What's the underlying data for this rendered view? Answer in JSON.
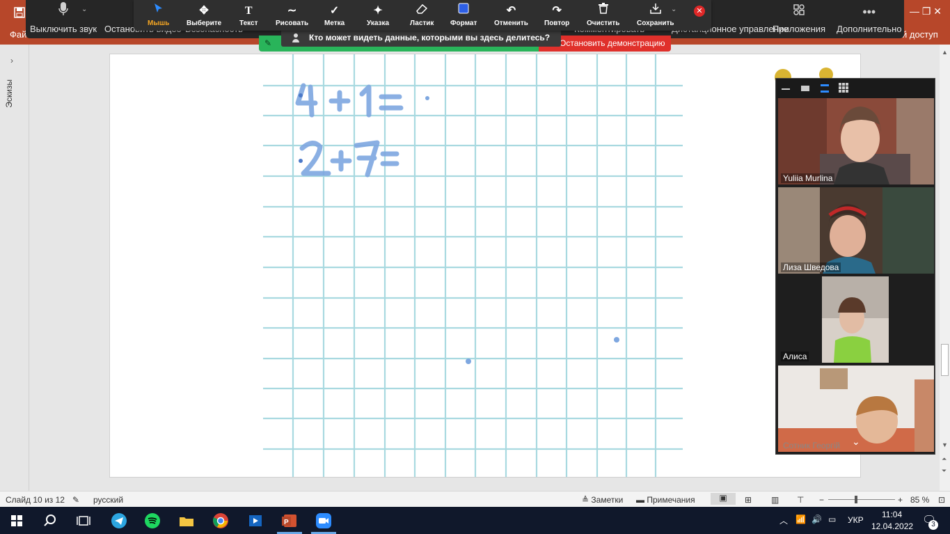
{
  "ppt": {
    "file_menu": "Фай",
    "right_label": "й доступ",
    "window_controls": "—  ❐  ✕"
  },
  "zoom_bar": {
    "items": [
      {
        "icon": "microphone-icon",
        "label": "Выключить звук"
      },
      {
        "icon": "video-icon",
        "label": "Остановить видео"
      },
      {
        "icon": "shield-icon",
        "label": "Безопасность"
      },
      {
        "icon": "comment-icon",
        "label": "Комментировать"
      },
      {
        "icon": "remote-control-icon",
        "label": "Дистанционное управление"
      },
      {
        "icon": "apps-icon",
        "label": "Приложения"
      },
      {
        "icon": "more-icon",
        "label": "Дополнительно"
      }
    ]
  },
  "annotate": {
    "tools": [
      {
        "icon": "cursor-icon",
        "label": "Мышь",
        "active": true
      },
      {
        "icon": "move-icon",
        "label": "Выберите"
      },
      {
        "icon": "text-icon",
        "label": "Текст"
      },
      {
        "icon": "draw-icon",
        "label": "Рисовать"
      },
      {
        "icon": "checkmark-icon",
        "label": "Метка"
      },
      {
        "icon": "spotlight-icon",
        "label": "Указка"
      },
      {
        "icon": "eraser-icon",
        "label": "Ластик"
      },
      {
        "icon": "format-icon",
        "label": "Формат"
      },
      {
        "icon": "undo-icon",
        "label": "Отменить"
      },
      {
        "icon": "redo-icon",
        "label": "Повтор"
      },
      {
        "icon": "trash-icon",
        "label": "Очистить"
      },
      {
        "icon": "download-icon",
        "label": "Сохранить"
      }
    ],
    "colors": {
      "accent": "#2d8cff",
      "active_label": "#f5a623",
      "close": "#e02828"
    }
  },
  "share": {
    "tooltip": "Кто может видеть данные, которыми вы здесь делитесь?",
    "stop_button": "Остановить демонстрацию",
    "banner_color": "#29b45a",
    "stop_color": "#e0302b"
  },
  "thumbnails": {
    "label": "Эскизы"
  },
  "slide": {
    "equations": [
      "4 + 1 =",
      "2 + 7 ="
    ],
    "ink_color": "#7ea7e0",
    "grid_color": "#a8d9e0"
  },
  "video": {
    "participants": [
      {
        "name": "Yuliia Murlina"
      },
      {
        "name": "Лиза Шведова"
      },
      {
        "name": "Алиса"
      },
      {
        "name": "Сотник Георгій"
      }
    ]
  },
  "status": {
    "slide": "Слайд 10 из 12",
    "language": "русский",
    "notes": "Заметки",
    "comments": "Примечания",
    "zoom_minus": "−",
    "zoom_plus": "+",
    "zoom": "85 %",
    "zoom_level": 0.85
  },
  "taskbar": {
    "language": "УКР",
    "time": "11:04",
    "date": "12.04.2022",
    "notifications": "3"
  }
}
